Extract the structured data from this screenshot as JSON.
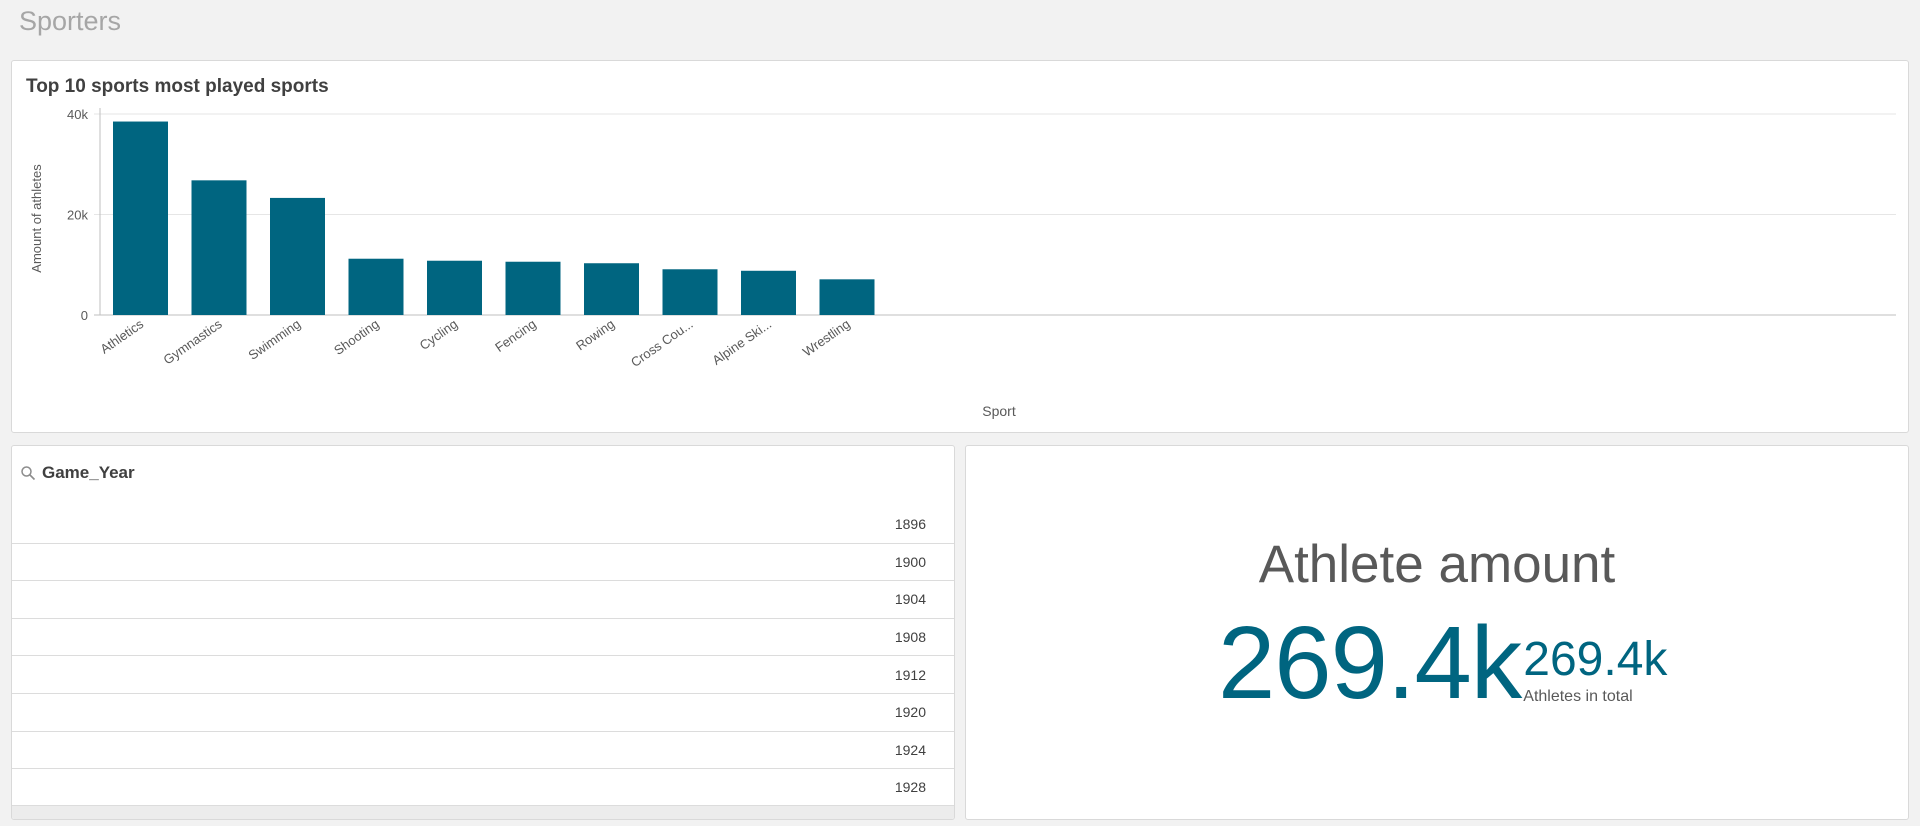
{
  "sheet": {
    "title": "Sporters"
  },
  "chart": {
    "title": "Top 10 sports most played sports"
  },
  "chart_data": {
    "type": "bar",
    "categories": [
      "Athletics",
      "Gymnastics",
      "Swimming",
      "Shooting",
      "Cycling",
      "Fencing",
      "Rowing",
      "Cross Cou...",
      "Alpine Ski...",
      "Wrestling"
    ],
    "values": [
      38500,
      26800,
      23300,
      11200,
      10800,
      10600,
      10300,
      9100,
      8800,
      7100
    ],
    "xlabel": "Sport",
    "ylabel": "Amount of athletes",
    "ylim": [
      0,
      40000
    ],
    "yticks": [
      0,
      20000,
      40000
    ],
    "ytick_labels": [
      "0",
      "20k",
      "40k"
    ],
    "bar_color": "#006580",
    "grid": true
  },
  "filter": {
    "title": "Game_Year",
    "icon": "search-icon",
    "values": [
      "1896",
      "1900",
      "1904",
      "1908",
      "1912",
      "1920",
      "1924",
      "1928"
    ]
  },
  "kpi": {
    "title": "Athlete amount",
    "main_value": "269.4k",
    "secondary_value": "269.4k",
    "secondary_label": "Athletes in total",
    "color": "#006580"
  }
}
